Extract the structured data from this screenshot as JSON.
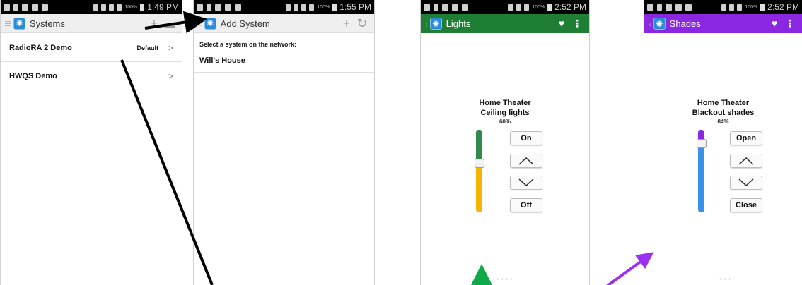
{
  "colors": {
    "accent_green": "#1e7e34",
    "accent_purple": "#8b27e0",
    "arrow_black": "#000000",
    "arrow_green": "#10a94a",
    "arrow_purple": "#9b30f0",
    "slider_green": "#2e8b4a",
    "slider_yellow": "#f5b400",
    "slider_purple": "#8b27e0",
    "slider_blue": "#3a92e8"
  },
  "status": {
    "screen1_time": "1:49 PM",
    "screen2_time": "1:55 PM",
    "screen3_time": "2:52 PM",
    "screen4_time": "2:52 PM",
    "battery_pct": "100%"
  },
  "systems_screen": {
    "title": "Systems",
    "add_icon": "plus-icon",
    "rows": [
      {
        "name": "RadioRA 2 Demo",
        "badge": "Default"
      },
      {
        "name": "HWQS Demo",
        "badge": ""
      }
    ]
  },
  "add_system_screen": {
    "title": "Add System",
    "add_icon": "plus-icon",
    "refresh_icon": "refresh-icon",
    "section_label": "Select a system on the network:",
    "systems": [
      "Will's House"
    ]
  },
  "lights_screen": {
    "title": "Lights",
    "room": "Home Theater",
    "device": "Ceiling lights",
    "level_label": "60%",
    "level": 0.6,
    "buttons": {
      "on": "On",
      "off": "Off"
    },
    "favorite_icon": "heart-icon",
    "menu_icon": "overflow-menu-icon"
  },
  "shades_screen": {
    "title": "Shades",
    "room": "Home Theater",
    "device": "Blackout shades",
    "level_label": "84%",
    "level": 0.84,
    "buttons": {
      "open": "Open",
      "close": "Close"
    },
    "favorite_icon": "heart-icon",
    "menu_icon": "overflow-menu-icon"
  },
  "page_indicator": "• • • •"
}
